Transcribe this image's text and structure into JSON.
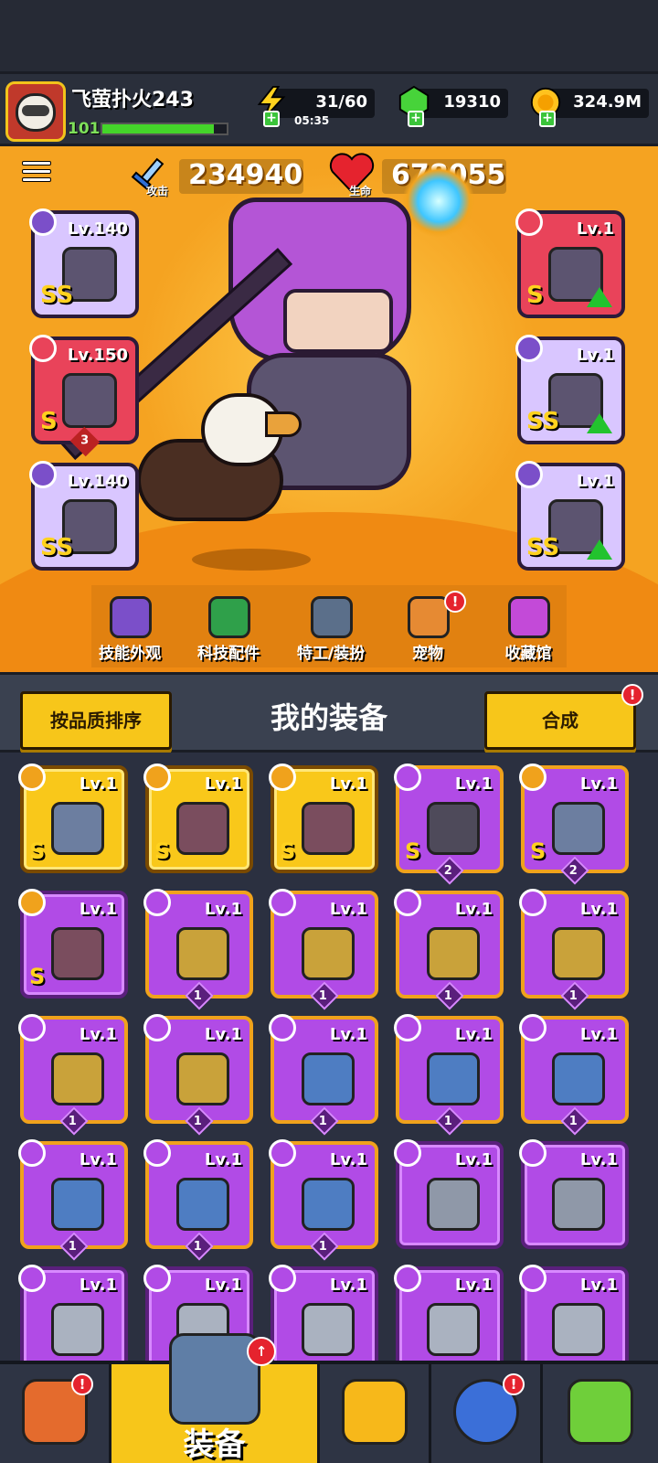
{
  "player": {
    "name": "飞萤扑火243",
    "level": "101",
    "xp_fraction": 0.9
  },
  "resources": {
    "energy": {
      "value": "31/60",
      "timer": "05:35",
      "icon": "lightning-icon"
    },
    "gems": {
      "value": "19310",
      "icon": "green-gem-icon"
    },
    "coins": {
      "value": "324.9M",
      "icon": "gold-coin-icon"
    }
  },
  "stats": {
    "attack": {
      "label": "攻击",
      "value": "234940",
      "icon": "sword-icon"
    },
    "hp": {
      "label": "生命",
      "value": "678055",
      "icon": "heart-icon"
    }
  },
  "equipped_left": [
    {
      "slot": "weapon",
      "level": "Lv.140",
      "rarity": "SS",
      "icon": "staff-icon",
      "bg": "#d9c6ff"
    },
    {
      "slot": "necklace",
      "level": "Lv.150",
      "rarity": "S",
      "icon": "chain-pendant-icon",
      "bg": "#e9435a",
      "count": "3"
    },
    {
      "slot": "gloves",
      "level": "Lv.140",
      "rarity": "SS",
      "icon": "gauntlet-icon",
      "bg": "#d9c6ff"
    }
  ],
  "equipped_right": [
    {
      "slot": "armor",
      "level": "Lv.1",
      "rarity": "S",
      "icon": "armor-icon",
      "bg": "#e9435a",
      "upgrade": true
    },
    {
      "slot": "belt",
      "level": "Lv.1",
      "rarity": "SS",
      "icon": "belt-icon",
      "bg": "#d9c6ff",
      "upgrade": true
    },
    {
      "slot": "boots",
      "level": "Lv.1",
      "rarity": "SS",
      "icon": "boots-icon",
      "bg": "#d9c6ff",
      "upgrade": true
    }
  ],
  "features": [
    {
      "label": "技能外观",
      "icon": "skill-skin-icon",
      "color": "#7b4fc9"
    },
    {
      "label": "科技配件",
      "icon": "tech-part-icon",
      "color": "#2fa04a"
    },
    {
      "label": "特工/装扮",
      "icon": "agent-costume-icon",
      "color": "#5b6f8a"
    },
    {
      "label": "宠物",
      "icon": "pet-icon",
      "color": "#e68a33",
      "badge": "!"
    },
    {
      "label": "收藏馆",
      "icon": "collection-chest-icon",
      "color": "#c34ad8"
    }
  ],
  "section": {
    "sort_label": "按品质排序",
    "title": "我的装备",
    "merge_label": "合成",
    "merge_badge": "!"
  },
  "inventory": [
    {
      "level": "Lv.1",
      "rarity": "S",
      "style": "gold",
      "icon": "armor-icon",
      "type": "armor-type-icon"
    },
    {
      "level": "Lv.1",
      "rarity": "S",
      "style": "gold",
      "icon": "boots-icon",
      "type": "boots-type-icon"
    },
    {
      "level": "Lv.1",
      "rarity": "S",
      "style": "gold",
      "icon": "boots-icon",
      "type": "boots-type-icon"
    },
    {
      "level": "Lv.1",
      "rarity": "S",
      "style": "gold-frame",
      "icon": "spiked-weapon-icon",
      "type": "weapon-type-icon",
      "count": "2"
    },
    {
      "level": "Lv.1",
      "rarity": "S",
      "style": "gold-frame",
      "icon": "armor-icon",
      "type": "armor-type-icon",
      "count": "2"
    },
    {
      "level": "Lv.1",
      "rarity": "S",
      "style": "purple",
      "icon": "boots-icon",
      "type": "boots-type-icon"
    },
    {
      "level": "Lv.1",
      "rarity": "",
      "style": "gold-frame",
      "icon": "chain-pendant-icon",
      "type": "necklace-type-icon",
      "count": "1"
    },
    {
      "level": "Lv.1",
      "rarity": "",
      "style": "gold-frame",
      "icon": "chain-pendant-icon",
      "type": "necklace-type-icon",
      "count": "1"
    },
    {
      "level": "Lv.1",
      "rarity": "",
      "style": "gold-frame",
      "icon": "chain-pendant-icon",
      "type": "necklace-type-icon",
      "count": "1"
    },
    {
      "level": "Lv.1",
      "rarity": "",
      "style": "gold-frame",
      "icon": "chain-pendant-icon",
      "type": "necklace-type-icon",
      "count": "1"
    },
    {
      "level": "Lv.1",
      "rarity": "",
      "style": "gold-frame",
      "icon": "chain-pendant-icon",
      "type": "necklace-type-icon",
      "count": "1"
    },
    {
      "level": "Lv.1",
      "rarity": "",
      "style": "gold-frame",
      "icon": "chain-pendant-icon",
      "type": "necklace-type-icon",
      "count": "1"
    },
    {
      "level": "Lv.1",
      "rarity": "",
      "style": "gold-frame",
      "icon": "shield-pendant-icon",
      "type": "necklace-type-icon",
      "count": "1"
    },
    {
      "level": "Lv.1",
      "rarity": "",
      "style": "gold-frame",
      "icon": "shield-pendant-icon",
      "type": "necklace-type-icon",
      "count": "1"
    },
    {
      "level": "Lv.1",
      "rarity": "",
      "style": "gold-frame",
      "icon": "shield-pendant-icon",
      "type": "necklace-type-icon",
      "count": "1"
    },
    {
      "level": "Lv.1",
      "rarity": "",
      "style": "gold-frame",
      "icon": "shield-pendant-icon",
      "type": "necklace-type-icon",
      "count": "1"
    },
    {
      "level": "Lv.1",
      "rarity": "",
      "style": "gold-frame",
      "icon": "shield-pendant-icon",
      "type": "necklace-type-icon",
      "count": "1"
    },
    {
      "level": "Lv.1",
      "rarity": "",
      "style": "gold-frame",
      "icon": "shield-pendant-icon",
      "type": "necklace-type-icon",
      "count": "1"
    },
    {
      "level": "Lv.1",
      "rarity": "",
      "style": "purple",
      "icon": "kunai-icon",
      "type": "weapon-type-icon"
    },
    {
      "level": "Lv.1",
      "rarity": "",
      "style": "purple",
      "icon": "kunai-icon",
      "type": "weapon-type-icon"
    },
    {
      "level": "Lv.1",
      "rarity": "",
      "style": "purple",
      "icon": "blade-icon",
      "type": "weapon-type-icon"
    },
    {
      "level": "Lv.1",
      "rarity": "",
      "style": "purple",
      "icon": "blade-icon",
      "type": "weapon-type-icon"
    },
    {
      "level": "Lv.1",
      "rarity": "",
      "style": "purple",
      "icon": "blade-icon",
      "type": "weapon-type-icon"
    },
    {
      "level": "Lv.1",
      "rarity": "",
      "style": "purple",
      "icon": "blade-icon",
      "type": "weapon-type-icon"
    },
    {
      "level": "Lv.1",
      "rarity": "",
      "style": "purple",
      "icon": "blade-icon",
      "type": "weapon-type-icon"
    }
  ],
  "nav": [
    {
      "label": "",
      "icon": "shop-icon",
      "badge": "!"
    },
    {
      "label": "装备",
      "icon": "equipment-shield-icon",
      "active": true,
      "badge": "↑"
    },
    {
      "label": "",
      "icon": "star-swords-icon"
    },
    {
      "label": "",
      "icon": "gacha-ball-icon",
      "badge": "!"
    },
    {
      "label": "",
      "icon": "dna-capsule-icon"
    }
  ]
}
